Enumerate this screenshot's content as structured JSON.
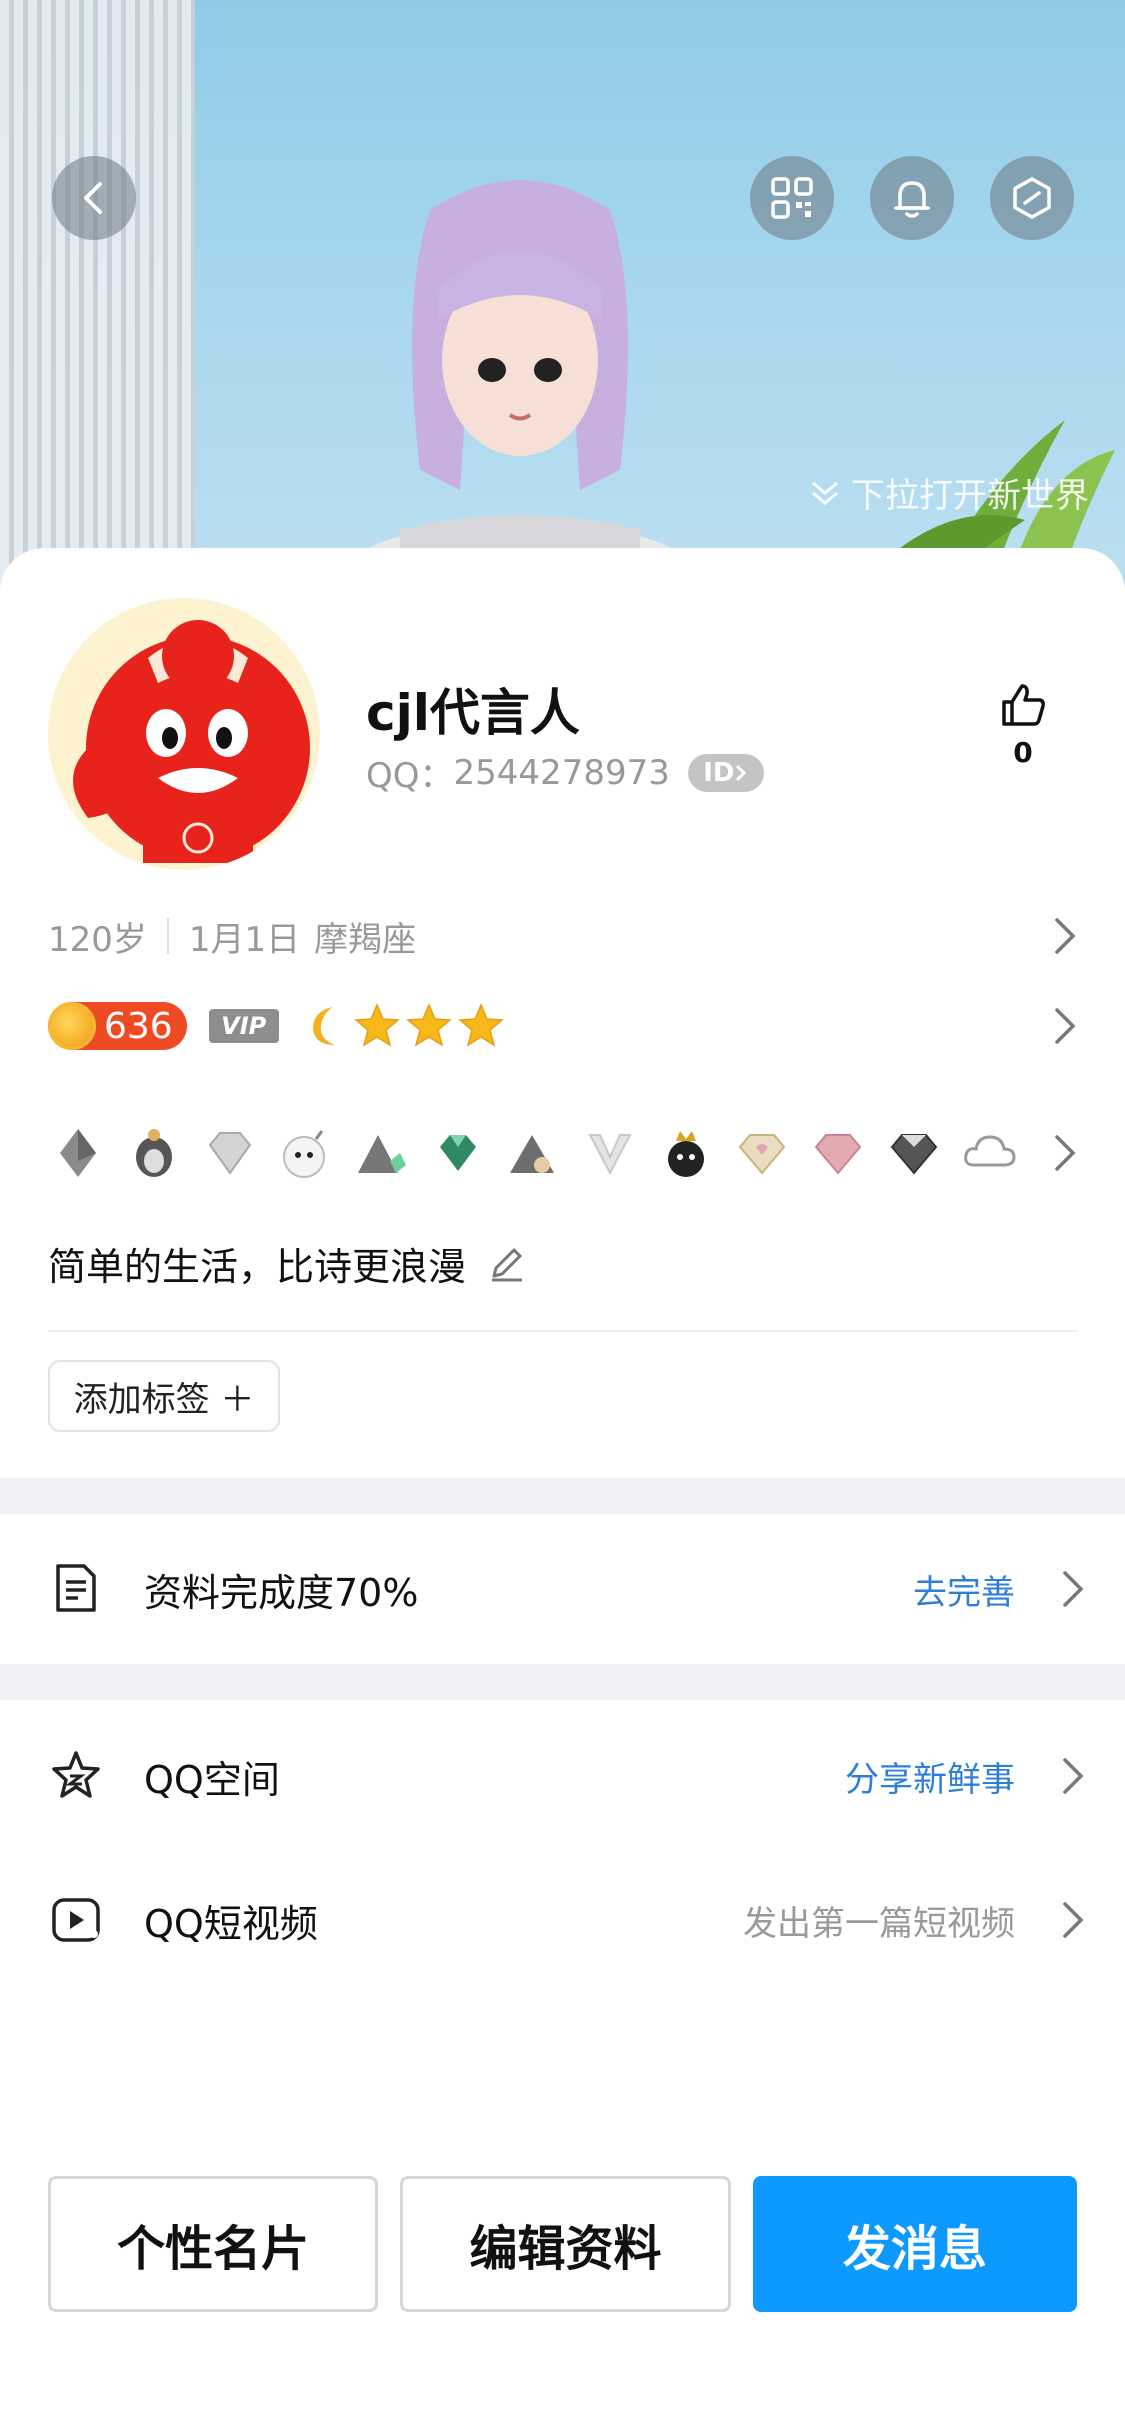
{
  "hero": {
    "pull_hint": "下拉打开新世界"
  },
  "profile": {
    "nickname": "cjl代言人",
    "qq_label": "QQ：",
    "qq_number": "2544278973",
    "id_badge": "ID",
    "like_count": "0",
    "age": "120岁",
    "birthday": "1月1日",
    "zodiac": "摩羯座",
    "level": "636",
    "vip_label": "VIP",
    "signature": "简单的生活，比诗更浪漫",
    "add_tag": "添加标签 ＋"
  },
  "completion": {
    "label": "资料完成度70%",
    "action": "去完善"
  },
  "services": [
    {
      "label": "QQ空间",
      "value": "分享新鲜事",
      "value_color": "#2f7fd9"
    },
    {
      "label": "QQ短视频",
      "value": "发出第一篇短视频",
      "value_color": "#999999"
    }
  ],
  "actions": {
    "card": "个性名片",
    "edit": "编辑资料",
    "message": "发消息"
  },
  "colors": {
    "accent": "#0d99ff",
    "link": "#2f7fd9"
  }
}
